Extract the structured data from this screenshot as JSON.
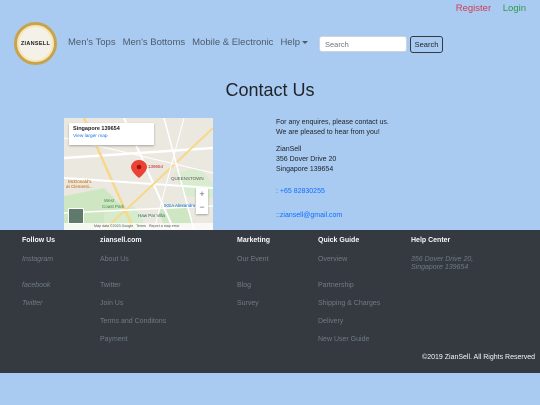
{
  "auth": {
    "register": "Register",
    "login": "Login"
  },
  "logo": {
    "text": "ZIANSELL"
  },
  "nav": {
    "items": [
      "Men's Tops",
      "Men's Bottoms",
      "Mobile & Electronic",
      "Help"
    ],
    "search_placeholder": "Search",
    "search_button": "Search"
  },
  "page_title": "Contact Us",
  "map": {
    "card_address": "Singapore 139654",
    "card_link": "View larger map",
    "pin_label": "139654",
    "labels": [
      "QUEENSTOWN",
      "McDonald's",
      "at Clementi...",
      "West",
      "Coast Park",
      "Haw Par Villa",
      "IKEA Alexandra"
    ],
    "zoom_in": "+",
    "zoom_out": "−",
    "footer": [
      "Map data ©2023 Google",
      "Terms",
      "Report a map error"
    ]
  },
  "contact": {
    "intro1": "For any enquires, please contact us.",
    "intro2": "We are pleased to hear from you!",
    "company": "ZianSell",
    "address1": "356 Dover Drive 20",
    "address2": "Singapore 139654",
    "phone": ": +65 82830255",
    "email": "::ziansell@gmail.com"
  },
  "footer": {
    "follow_head": "Follow Us",
    "follow": [
      "Instagram",
      "facebook",
      "Twitter"
    ],
    "site_head": "ziansell.com",
    "site": [
      "About Us",
      "Twitter",
      "Join Us",
      "Terms and Conditons",
      "Payment"
    ],
    "marketing_head": "Marketing",
    "marketing": [
      "Our Event",
      "Blog",
      "Survey"
    ],
    "guide_head": "Quick Guide",
    "guide": [
      "Overview",
      "Partnership",
      "Shipping & Charges",
      "Delivery",
      "New User Guide"
    ],
    "help_head": "Help Center",
    "help_address1": "356 Dover Drive 20,",
    "help_address2": "Singapore 139654",
    "copyright": "©2019 ZianSell. All Rights Reserved"
  }
}
